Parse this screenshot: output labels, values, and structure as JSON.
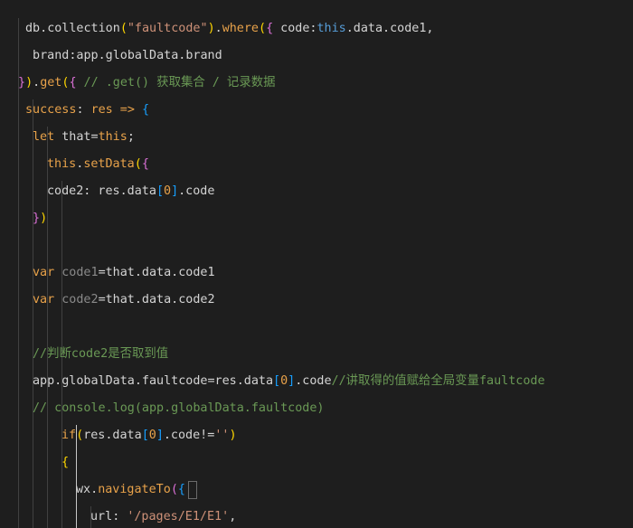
{
  "editor": {
    "language": "javascript",
    "colors": {
      "background": "#1e1e1e",
      "default": "#d4d4d4",
      "keyword": "#c586c0",
      "keyword_blue": "#569cd6",
      "function": "#dcdcaa",
      "string": "#ce9178",
      "comment": "#6a9955",
      "property": "#9cdcfe",
      "number": "#b5cea8",
      "bracket_gold": "#ffd700",
      "bracket_purple": "#da70d6",
      "bracket_blue": "#179fff",
      "orange": "#e8a24a"
    },
    "lines": [
      {
        "indent": 1,
        "tokens": [
          {
            "t": "db.",
            "c": "default"
          },
          {
            "t": "collection",
            "c": "default"
          },
          {
            "t": "(",
            "c": "bracket_gold"
          },
          {
            "t": "\"faultcode\"",
            "c": "string"
          },
          {
            "t": ")",
            "c": "bracket_gold"
          },
          {
            "t": ".",
            "c": "default"
          },
          {
            "t": "where",
            "c": "orange"
          },
          {
            "t": "(",
            "c": "bracket_gold"
          },
          {
            "t": "{",
            "c": "bracket_purple"
          },
          {
            "t": " code:",
            "c": "default"
          },
          {
            "t": "this",
            "c": "keyword_blue"
          },
          {
            "t": ".data.code1,",
            "c": "default"
          }
        ]
      },
      {
        "indent": 1,
        "tokens": [
          {
            "t": " brand:app.globalData.brand",
            "c": "default"
          }
        ]
      },
      {
        "indent": 0,
        "tokens": [
          {
            "t": "}",
            "c": "bracket_purple"
          },
          {
            "t": ")",
            "c": "bracket_gold"
          },
          {
            "t": ".",
            "c": "default"
          },
          {
            "t": "get",
            "c": "orange"
          },
          {
            "t": "(",
            "c": "bracket_gold"
          },
          {
            "t": "{",
            "c": "bracket_purple"
          },
          {
            "t": " // .get() 获取集合 / 记录数据",
            "c": "comment"
          }
        ]
      },
      {
        "indent": 1,
        "tokens": [
          {
            "t": "success",
            "c": "orange"
          },
          {
            "t": ": ",
            "c": "default"
          },
          {
            "t": "res",
            "c": "orange"
          },
          {
            "t": " => ",
            "c": "orange"
          },
          {
            "t": "{",
            "c": "bracket_blue"
          }
        ]
      },
      {
        "indent": 2,
        "tokens": [
          {
            "t": "let",
            "c": "orange"
          },
          {
            "t": " that=",
            "c": "default"
          },
          {
            "t": "this",
            "c": "orange"
          },
          {
            "t": ";",
            "c": "default"
          }
        ]
      },
      {
        "indent": 3,
        "tokens": [
          {
            "t": "this",
            "c": "orange"
          },
          {
            "t": ".",
            "c": "default"
          },
          {
            "t": "setData",
            "c": "orange"
          },
          {
            "t": "(",
            "c": "bracket_gold"
          },
          {
            "t": "{",
            "c": "bracket_purple"
          }
        ]
      },
      {
        "indent": 3,
        "tokens": [
          {
            "t": "code2: res.data",
            "c": "default"
          },
          {
            "t": "[",
            "c": "bracket_blue"
          },
          {
            "t": "0",
            "c": "orange"
          },
          {
            "t": "]",
            "c": "bracket_blue"
          },
          {
            "t": ".code",
            "c": "default"
          }
        ]
      },
      {
        "indent": 2,
        "tokens": [
          {
            "t": "}",
            "c": "bracket_purple"
          },
          {
            "t": ")",
            "c": "bracket_gold"
          }
        ]
      },
      {
        "indent": 2,
        "tokens": []
      },
      {
        "indent": 2,
        "tokens": [
          {
            "t": "var",
            "c": "orange"
          },
          {
            "t": " code1",
            "c": "comment_dim"
          },
          {
            "t": "=that.data.code1",
            "c": "default"
          }
        ]
      },
      {
        "indent": 2,
        "tokens": [
          {
            "t": "var",
            "c": "orange"
          },
          {
            "t": " code2",
            "c": "comment_dim"
          },
          {
            "t": "=that.data.code2",
            "c": "default"
          }
        ]
      },
      {
        "indent": 2,
        "tokens": []
      },
      {
        "indent": 2,
        "tokens": [
          {
            "t": "//判断code2是否取到值",
            "c": "comment"
          }
        ]
      },
      {
        "indent": 2,
        "tokens": [
          {
            "t": "app.globalData.faultcode=res.data",
            "c": "default"
          },
          {
            "t": "[",
            "c": "bracket_blue"
          },
          {
            "t": "0",
            "c": "orange"
          },
          {
            "t": "]",
            "c": "bracket_blue"
          },
          {
            "t": ".code",
            "c": "default"
          },
          {
            "t": "//讲取得的值赋给全局变量faultcode",
            "c": "comment"
          }
        ]
      },
      {
        "indent": 2,
        "tokens": [
          {
            "t": "// console.log(app.globalData.faultcode)",
            "c": "comment"
          }
        ]
      },
      {
        "indent": 4,
        "tokens": [
          {
            "t": "if",
            "c": "orange"
          },
          {
            "t": "(",
            "c": "bracket_gold"
          },
          {
            "t": "res.data",
            "c": "default"
          },
          {
            "t": "[",
            "c": "bracket_blue"
          },
          {
            "t": "0",
            "c": "orange"
          },
          {
            "t": "]",
            "c": "bracket_blue"
          },
          {
            "t": ".code!=",
            "c": "default"
          },
          {
            "t": "''",
            "c": "string"
          },
          {
            "t": ")",
            "c": "bracket_gold"
          }
        ]
      },
      {
        "indent": 4,
        "tokens": [
          {
            "t": "{",
            "c": "bracket_gold"
          }
        ]
      },
      {
        "indent": 5,
        "tokens": [
          {
            "t": "wx.",
            "c": "default"
          },
          {
            "t": "navigateTo",
            "c": "orange"
          },
          {
            "t": "(",
            "c": "bracket_purple"
          },
          {
            "t": "{",
            "c": "bracket_blue"
          }
        ]
      },
      {
        "indent": 6,
        "tokens": [
          {
            "t": "url",
            "c": "default"
          },
          {
            "t": ": ",
            "c": "default"
          },
          {
            "t": "'/pages/E1/E1'",
            "c": "string"
          },
          {
            "t": ",",
            "c": "default"
          }
        ]
      }
    ]
  }
}
